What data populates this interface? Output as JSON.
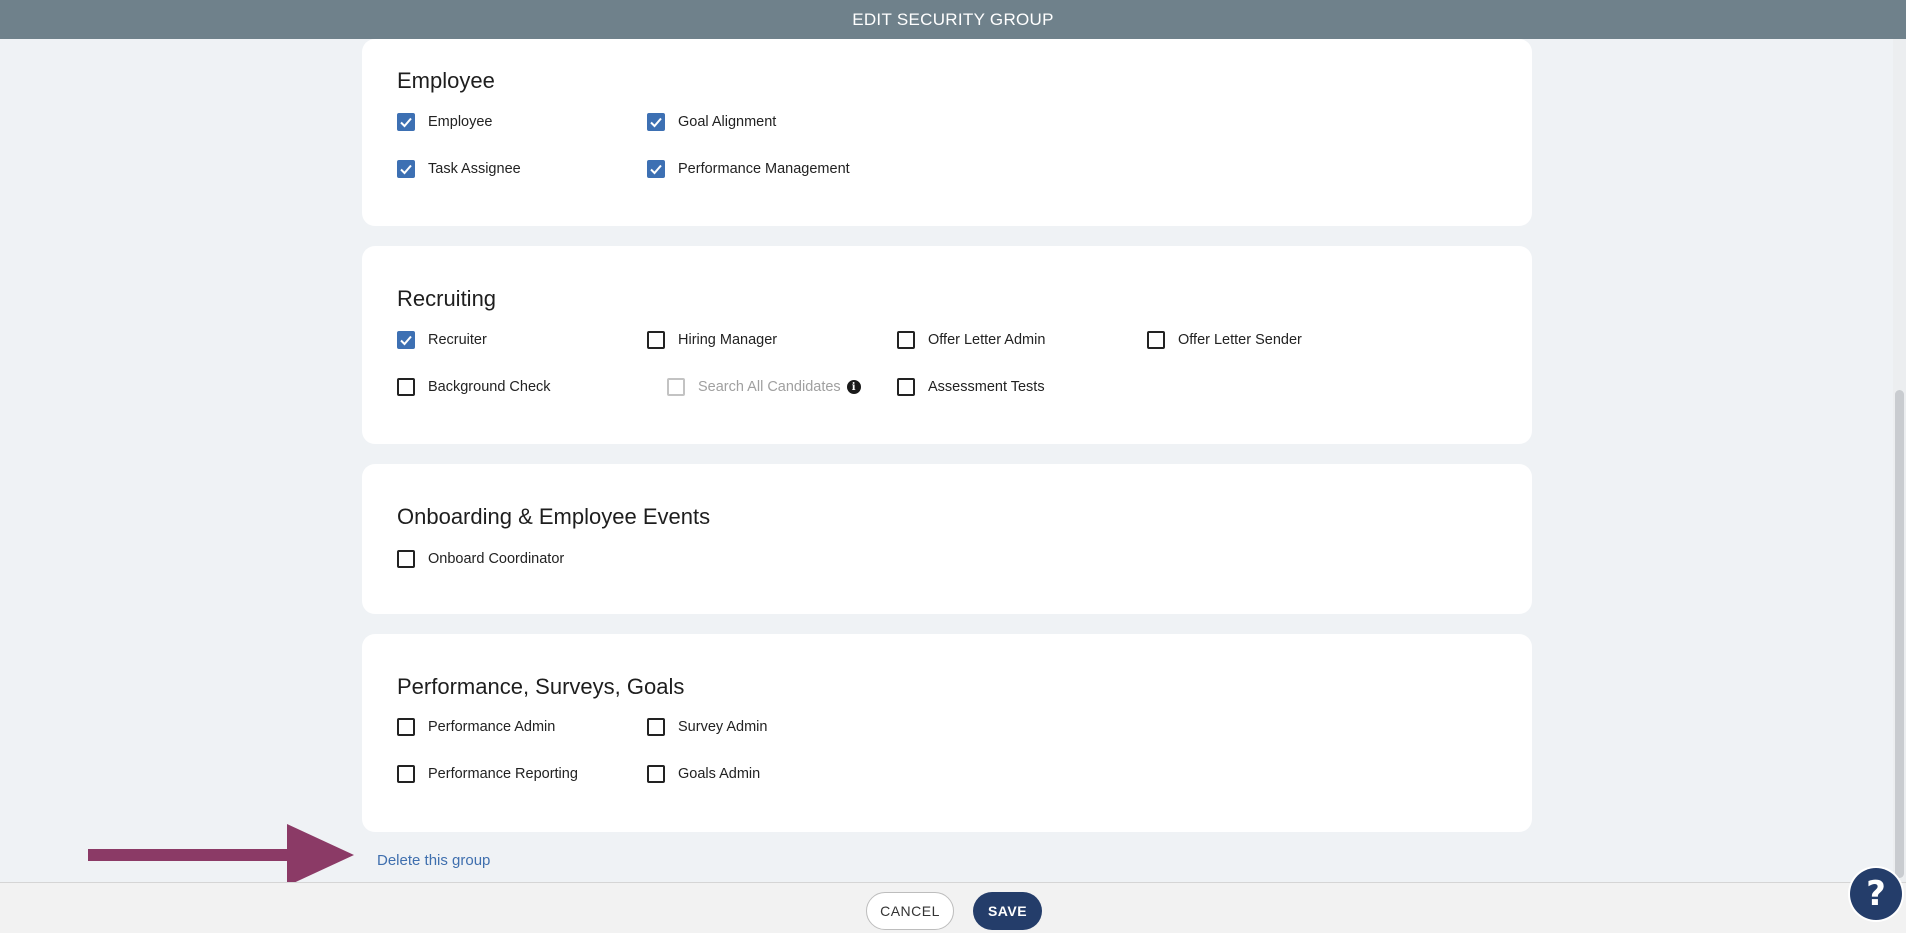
{
  "header": {
    "title": "EDIT SECURITY GROUP"
  },
  "sections": [
    {
      "title": "Employee",
      "options": [
        {
          "label": "Employee",
          "checked": true
        },
        {
          "label": "Goal Alignment",
          "checked": true
        },
        {
          "label": "Task Assignee",
          "checked": true
        },
        {
          "label": "Performance Management",
          "checked": true
        }
      ]
    },
    {
      "title": "Recruiting",
      "options": [
        {
          "label": "Recruiter",
          "checked": true
        },
        {
          "label": "Hiring Manager",
          "checked": false
        },
        {
          "label": "Offer Letter Admin",
          "checked": false
        },
        {
          "label": "Offer Letter Sender",
          "checked": false
        },
        {
          "label": "Background Check",
          "checked": false
        },
        {
          "label": "Search All Candidates",
          "checked": false,
          "disabled": true,
          "info_icon": "info-icon"
        },
        {
          "label": "Assessment Tests",
          "checked": false
        }
      ]
    },
    {
      "title": "Onboarding & Employee Events",
      "options": [
        {
          "label": "Onboard Coordinator",
          "checked": false
        }
      ]
    },
    {
      "title": "Performance, Surveys, Goals",
      "options": [
        {
          "label": "Performance Admin",
          "checked": false
        },
        {
          "label": "Survey Admin",
          "checked": false
        },
        {
          "label": "Performance Reporting",
          "checked": false
        },
        {
          "label": "Goals Admin",
          "checked": false
        }
      ]
    }
  ],
  "delete_link": "Delete this group",
  "footer": {
    "cancel_label": "CANCEL",
    "save_label": "SAVE"
  },
  "help": {
    "label": "?",
    "icon": "question-mark-icon"
  },
  "annotation": {
    "icon": "arrow-right-icon",
    "color": "#8b3a66"
  },
  "colors": {
    "header": "#6f818b",
    "accent": "#3d70b3",
    "primary": "#243d6a",
    "link": "#3f6fae"
  }
}
